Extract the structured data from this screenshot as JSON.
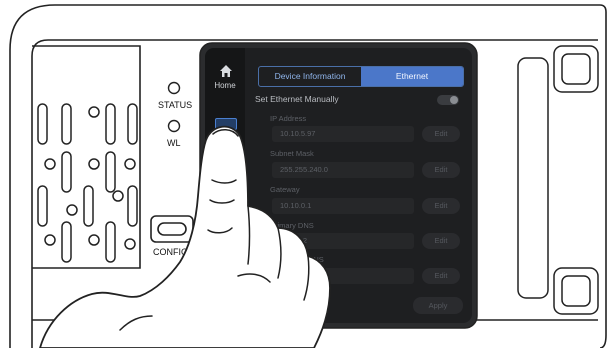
{
  "device": {
    "status_label": "STATUS",
    "wl_label": "WL",
    "config_label": "CONFIG"
  },
  "screen": {
    "sidebar": {
      "home_label": "Home",
      "home_icon": "home-icon",
      "network_icon": "network-icon"
    },
    "tabs": [
      {
        "label": "Device Information",
        "active": false
      },
      {
        "label": "Ethernet",
        "active": true
      }
    ],
    "manual_label": "Set Ethernet Manually",
    "manual_toggle": "off",
    "fields": [
      {
        "label": "IP Address",
        "value": "10.10.5.97",
        "button": "Edit"
      },
      {
        "label": "Subnet Mask",
        "value": "255.255.240.0",
        "button": "Edit"
      },
      {
        "label": "Gateway",
        "value": "10.10.0.1",
        "button": "Edit"
      },
      {
        "label": "Primary DNS",
        "value": "10.0.0.2",
        "button": "Edit"
      },
      {
        "label": "Secondary DNS",
        "value": "10.0.0.3",
        "button": "Edit"
      }
    ],
    "apply_label": "Apply"
  },
  "colors": {
    "screen_bg": "#1e1f21",
    "accent": "#4b77c9",
    "chassis_line": "#222222"
  }
}
